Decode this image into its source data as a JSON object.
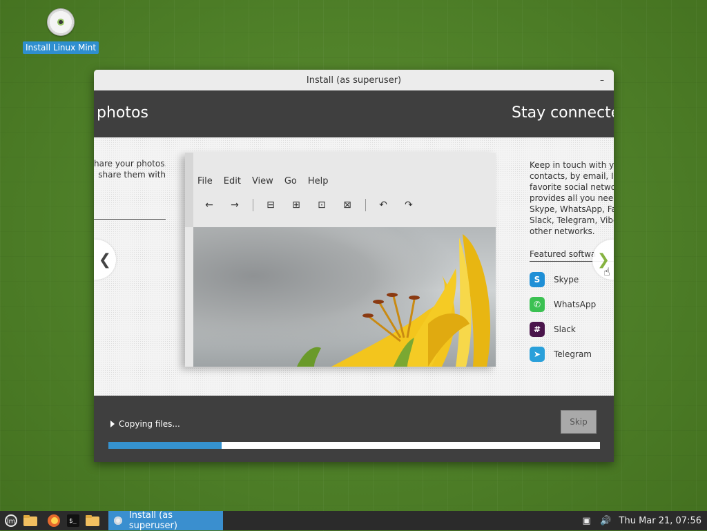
{
  "desktop": {
    "install_icon_label": "Install Linux Mint"
  },
  "window": {
    "title": "Install (as superuser)",
    "minimize_glyph": "–"
  },
  "slides": {
    "left_title": "photos",
    "right_title": "Stay connecte",
    "left_text": [
      "hare your photos.",
      "share them with"
    ],
    "right_text": [
      "Keep in touch with you",
      "contacts, by email, IRC",
      "favorite social network",
      "provides all you need t",
      "Skype, WhatsApp, Face",
      "Slack, Telegram, Viber,",
      "other networks."
    ],
    "featured_label": "Featured softwa",
    "apps": [
      {
        "name": "Skype",
        "icon": "skype-icon",
        "color": "#1e8fd6"
      },
      {
        "name": "WhatsApp",
        "icon": "whatsapp-icon",
        "color": "#3bc152"
      },
      {
        "name": "Slack",
        "icon": "slack-icon",
        "color": "#e01e5a"
      },
      {
        "name": "Telegram",
        "icon": "telegram-icon",
        "color": "#2aa0da"
      }
    ],
    "preview_menu": [
      "File",
      "Edit",
      "View",
      "Go",
      "Help"
    ],
    "prev_glyph": "❮",
    "next_glyph": "❯"
  },
  "bottom": {
    "status": "Copying files...",
    "skip_label": "Skip",
    "progress": 0.23,
    "accent": "#3592cf"
  },
  "taskbar": {
    "task_label": "Install (as superuser)",
    "clock": "Thu Mar 21, 07:56"
  }
}
